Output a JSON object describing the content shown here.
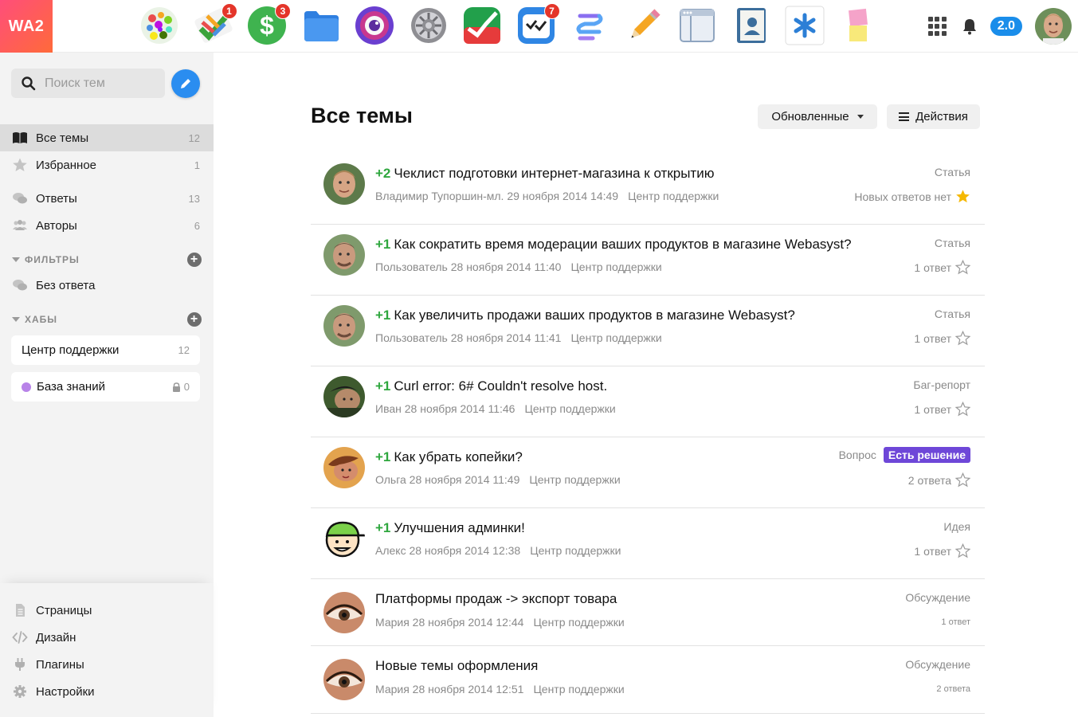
{
  "topbar": {
    "logo": "WA2",
    "apps": [
      {
        "name": "site-app-icon",
        "badge": ""
      },
      {
        "name": "tasks-app-icon",
        "badge": "1"
      },
      {
        "name": "money-app-icon",
        "badge": "3"
      },
      {
        "name": "files-app-icon",
        "badge": ""
      },
      {
        "name": "photos-app-icon",
        "badge": ""
      },
      {
        "name": "settings-app-icon",
        "badge": ""
      },
      {
        "name": "cash-flow-app-icon",
        "badge": ""
      },
      {
        "name": "checklists-app-icon",
        "badge": "7"
      },
      {
        "name": "hub-app-icon",
        "badge": ""
      },
      {
        "name": "notes-pencil-app-icon",
        "badge": ""
      },
      {
        "name": "site-builder-app-icon",
        "badge": ""
      },
      {
        "name": "contacts-app-icon",
        "badge": ""
      },
      {
        "name": "helpdesk-app-icon",
        "badge": ""
      },
      {
        "name": "stickies-app-icon",
        "badge": ""
      }
    ],
    "version": "2.0"
  },
  "sidebar": {
    "search_placeholder": "Поиск тем",
    "nav": [
      {
        "label": "Все темы",
        "count": "12",
        "icon": "book-icon"
      },
      {
        "label": "Избранное",
        "count": "1",
        "icon": "star-icon"
      },
      {
        "label": "Ответы",
        "count": "13",
        "icon": "comments-icon"
      },
      {
        "label": "Авторы",
        "count": "6",
        "icon": "users-icon"
      }
    ],
    "filters_heading": "ФИЛЬТРЫ",
    "filters": [
      {
        "label": "Без ответа",
        "icon": "comments-icon"
      }
    ],
    "hubs_heading": "ХАБЫ",
    "hubs": [
      {
        "label": "Центр поддержки",
        "count": "12"
      },
      {
        "label": "База знаний",
        "count": "0"
      }
    ],
    "bottom": [
      {
        "label": "Страницы",
        "icon": "page-icon"
      },
      {
        "label": "Дизайн",
        "icon": "code-icon"
      },
      {
        "label": "Плагины",
        "icon": "plug-icon"
      },
      {
        "label": "Настройки",
        "icon": "gear-icon"
      }
    ]
  },
  "main": {
    "title": "Все темы",
    "sort_label": "Обновленные",
    "actions_label": "Действия",
    "topics": [
      {
        "votes": "+2",
        "title": "Чеклист подготовки интернет-магазина к открытию",
        "author_date": "Владимир Тупоршин-мл. 29 ноября 2014 14:49",
        "hub": "Центр поддержки",
        "type": "Статья",
        "replies": "Новых ответов нет",
        "starred": true,
        "solved": ""
      },
      {
        "votes": "+1",
        "title": "Как сократить время модерации ваших продуктов в магазине Webasyst?",
        "author_date": "Пользователь 28 ноября 2014 11:40",
        "hub": "Центр поддержки",
        "type": "Статья",
        "replies": "1 ответ",
        "starred": false,
        "solved": ""
      },
      {
        "votes": "+1",
        "title": "Как увеличить продажи ваших продуктов в магазине Webasyst?",
        "author_date": "Пользователь 28 ноября 2014 11:41",
        "hub": "Центр поддержки",
        "type": "Статья",
        "replies": "1 ответ",
        "starred": false,
        "solved": ""
      },
      {
        "votes": "+1",
        "title": "Curl error: 6# Couldn't resolve host.",
        "author_date": "Иван 28 ноября 2014 11:46",
        "hub": "Центр поддержки",
        "type": "Баг-репорт",
        "replies": "1 ответ",
        "starred": false,
        "solved": ""
      },
      {
        "votes": "+1",
        "title": "Как убрать копейки?",
        "author_date": "Ольга 28 ноября 2014 11:49",
        "hub": "Центр поддержки",
        "type": "Вопрос",
        "replies": "2 ответа",
        "starred": false,
        "solved": "Есть решение"
      },
      {
        "votes": "+1",
        "title": "Улучшения админки!",
        "author_date": "Алекс 28 ноября 2014 12:38",
        "hub": "Центр поддержки",
        "type": "Идея",
        "replies": "1 ответ",
        "starred": false,
        "solved": ""
      },
      {
        "votes": "",
        "title": "Платформы продаж -> экспорт товара",
        "author_date": "Мария 28 ноября 2014 12:44",
        "hub": "Центр поддержки",
        "type": "Обсуждение",
        "replies": "1 ответ",
        "starred": null,
        "solved": ""
      },
      {
        "votes": "",
        "title": "Новые темы оформления",
        "author_date": "Мария 28 ноября 2014 12:51",
        "hub": "Центр поддержки",
        "type": "Обсуждение",
        "replies": "2 ответа",
        "starred": null,
        "solved": ""
      }
    ]
  },
  "colors": {
    "accent": "#1a8dea",
    "votes": "#2fa73e",
    "solved": "#6e47d8",
    "badge": "#e4352a",
    "star": "#f5b800"
  }
}
